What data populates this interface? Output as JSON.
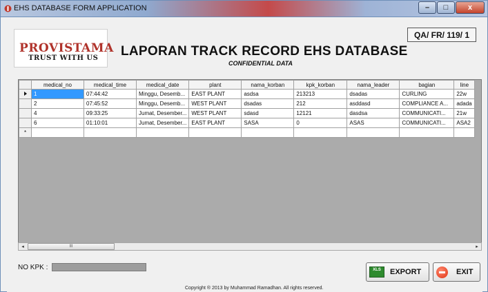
{
  "window": {
    "title": "EHS DATABASE FORM APPLICATION",
    "minimize_label": "–",
    "maximize_label": "□",
    "close_label": "x"
  },
  "header": {
    "logo_main": "PROVISTAMA",
    "logo_sub": "TRUST WITH US",
    "doc_code": "QA/ FR/ 119/ 1",
    "title": "LAPORAN TRACK RECORD EHS DATABASE",
    "subtitle": "CONFIDENTIAL DATA"
  },
  "grid": {
    "columns": [
      "medical_no",
      "medical_time",
      "medical_date",
      "plant",
      "nama_korban",
      "kpk_korban",
      "nama_leader",
      "bagian",
      "line"
    ],
    "rows": [
      [
        "1",
        "07:44:42",
        "Minggu, Desemb...",
        "EAST PLANT",
        "asdsa",
        "213213",
        "dsadas",
        "CURLING",
        "22w"
      ],
      [
        "2",
        "07:45:52",
        "Minggu, Desemb...",
        "WEST PLANT",
        "dsadas",
        "212",
        "asddasd",
        "COMPLIANCE A...",
        "adada"
      ],
      [
        "4",
        "09:33:25",
        "Jumat, Desember...",
        "WEST PLANT",
        "sdasd",
        "12121",
        "dasdsa",
        "COMMUNICATI...",
        "21w"
      ],
      [
        "6",
        "01:10:01",
        "Jumat, Desember...",
        "EAST PLANT",
        "SASA",
        "0",
        "ASAS",
        "COMMUNICATI...",
        "ASA2"
      ]
    ],
    "new_row_marker": "*",
    "scroll_left": "◂",
    "scroll_right": "▸",
    "scroll_thumb": "III"
  },
  "footer": {
    "nokpk_label": "NO KPK :",
    "nokpk_value": "",
    "export_label": "EXPORT",
    "exit_label": "EXIT",
    "xls_icon_text": "XLS",
    "copyright": "Copyright ® 2013 by Muhammad Ramadhan. All rights reserved."
  }
}
